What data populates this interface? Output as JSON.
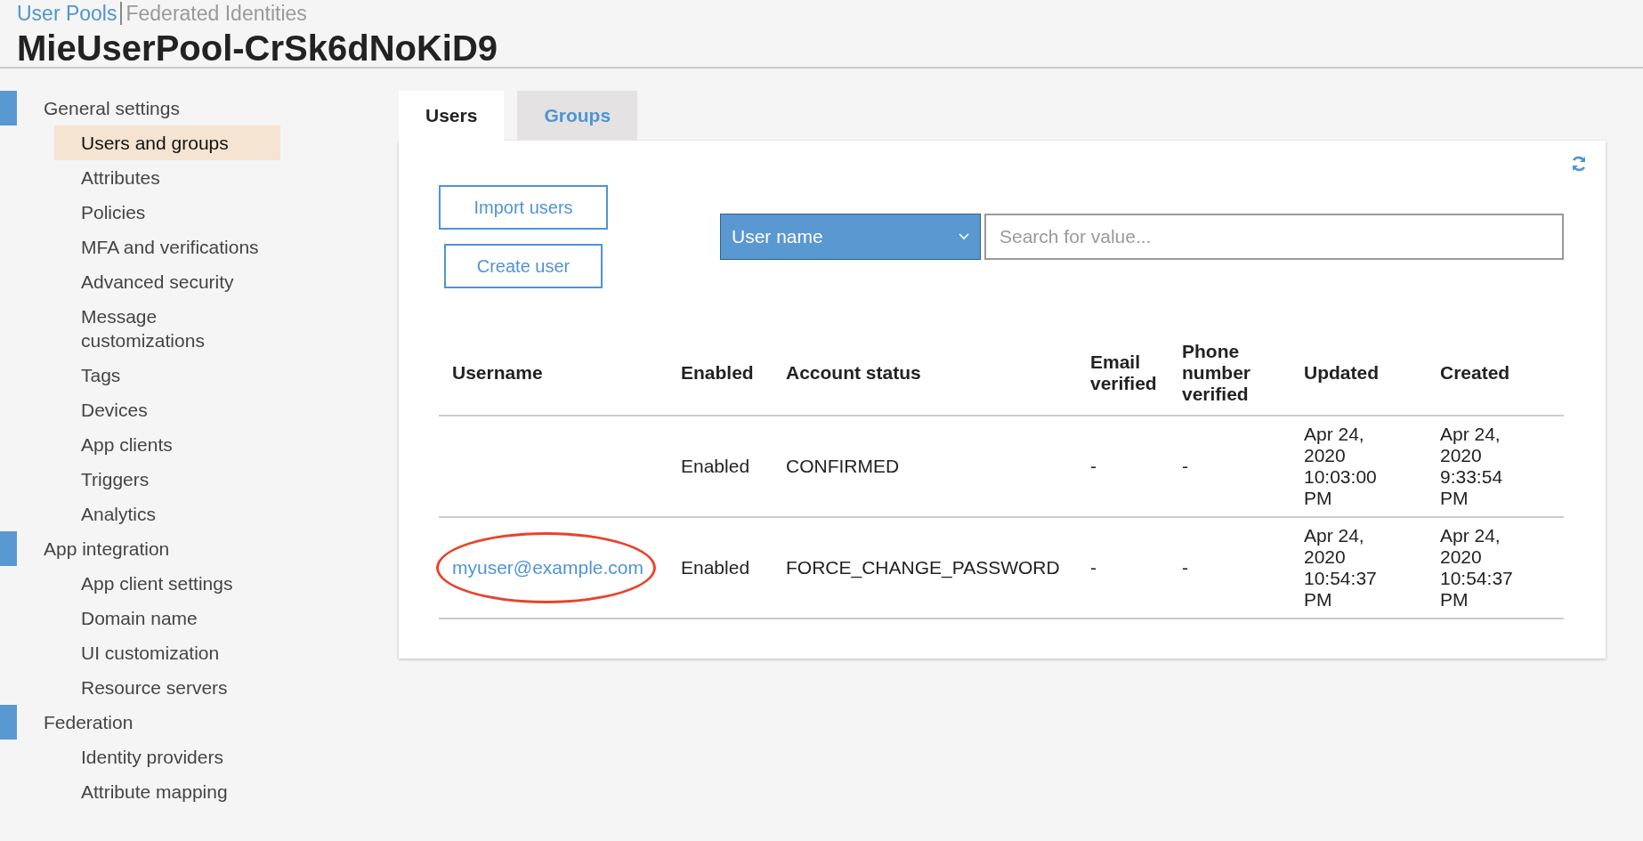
{
  "breadcrumb": [
    {
      "label": "User Pools",
      "selected": true
    },
    {
      "label": "Federated Identities",
      "selected": false
    }
  ],
  "page_title": "MieUserPool-CrSk6dNoKiD9",
  "sidebar": {
    "sections": [
      {
        "label": "General settings",
        "items": [
          {
            "label": "Users and groups",
            "selected": true
          },
          {
            "label": "Attributes",
            "selected": false
          },
          {
            "label": "Policies",
            "selected": false
          },
          {
            "label": "MFA and verifications",
            "selected": false
          },
          {
            "label": "Advanced security",
            "selected": false
          },
          {
            "label": "Message customizations",
            "selected": false
          },
          {
            "label": "Tags",
            "selected": false
          },
          {
            "label": "Devices",
            "selected": false
          },
          {
            "label": "App clients",
            "selected": false
          },
          {
            "label": "Triggers",
            "selected": false
          },
          {
            "label": "Analytics",
            "selected": false
          }
        ]
      },
      {
        "label": "App integration",
        "items": [
          {
            "label": "App client settings",
            "selected": false
          },
          {
            "label": "Domain name",
            "selected": false
          },
          {
            "label": "UI customization",
            "selected": false
          },
          {
            "label": "Resource servers",
            "selected": false
          }
        ]
      },
      {
        "label": "Federation",
        "items": [
          {
            "label": "Identity providers",
            "selected": false
          },
          {
            "label": "Attribute mapping",
            "selected": false
          }
        ]
      }
    ]
  },
  "tabs": [
    {
      "label": "Users",
      "selected": true
    },
    {
      "label": "Groups",
      "selected": false
    }
  ],
  "buttons": [
    "Import users",
    "Create user"
  ],
  "filter": {
    "attribute": "User name",
    "search": {
      "placeholder": "Search for value..."
    }
  },
  "table": {
    "columns": [
      "Username",
      "Enabled",
      "Account status",
      "Email verified",
      "Phone number verified",
      "Updated",
      "Created"
    ],
    "rows": [
      {
        "username": "",
        "username_circled": false,
        "enabled": "Enabled",
        "account_status": "CONFIRMED",
        "email_verified": "-",
        "phone_verified": "-",
        "updated": "Apr 24, 2020 10:03:00 PM",
        "created": "Apr 24, 2020 9:33:54 PM"
      },
      {
        "username": "myuser@example.com",
        "username_circled": true,
        "enabled": "Enabled",
        "account_status": "FORCE_CHANGE_PASSWORD",
        "email_verified": "-",
        "phone_verified": "-",
        "updated": "Apr 24, 2020 10:54:37 PM",
        "created": "Apr 24, 2020 10:54:37 PM"
      }
    ]
  }
}
